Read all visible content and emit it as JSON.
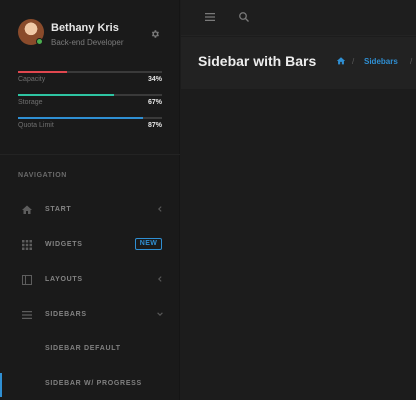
{
  "user": {
    "name": "Bethany Kris",
    "role": "Back-end Developer"
  },
  "bars": [
    {
      "label": "Capacity",
      "value": "34%",
      "fraction": 0.34,
      "color": "#e0474f"
    },
    {
      "label": "Storage",
      "value": "67%",
      "fraction": 0.67,
      "color": "#2ec4a2"
    },
    {
      "label": "Quota Limit",
      "value": "87%",
      "fraction": 0.87,
      "color": "#2f8fd3"
    }
  ],
  "nav": {
    "title": "NAVIGATION",
    "items": [
      {
        "label": "START",
        "icon": "home-icon",
        "expandable": true
      },
      {
        "label": "WIDGETS",
        "icon": "grid-icon",
        "badge": "NEW"
      },
      {
        "label": "LAYOUTS",
        "icon": "layout-icon",
        "expandable": true
      },
      {
        "label": "SIDEBARS",
        "icon": "menu-icon",
        "expanded": true
      }
    ],
    "sub_items": [
      {
        "label": "SIDEBAR DEFAULT"
      },
      {
        "label": "SIDEBAR W/ PROGRESS",
        "active": true
      }
    ]
  },
  "page": {
    "title": "Sidebar with Bars",
    "breadcrumb": {
      "separator": "/",
      "link": "Sidebars"
    }
  },
  "colors": {
    "accent": "#2f8fd3",
    "status_online": "#4caf50"
  }
}
